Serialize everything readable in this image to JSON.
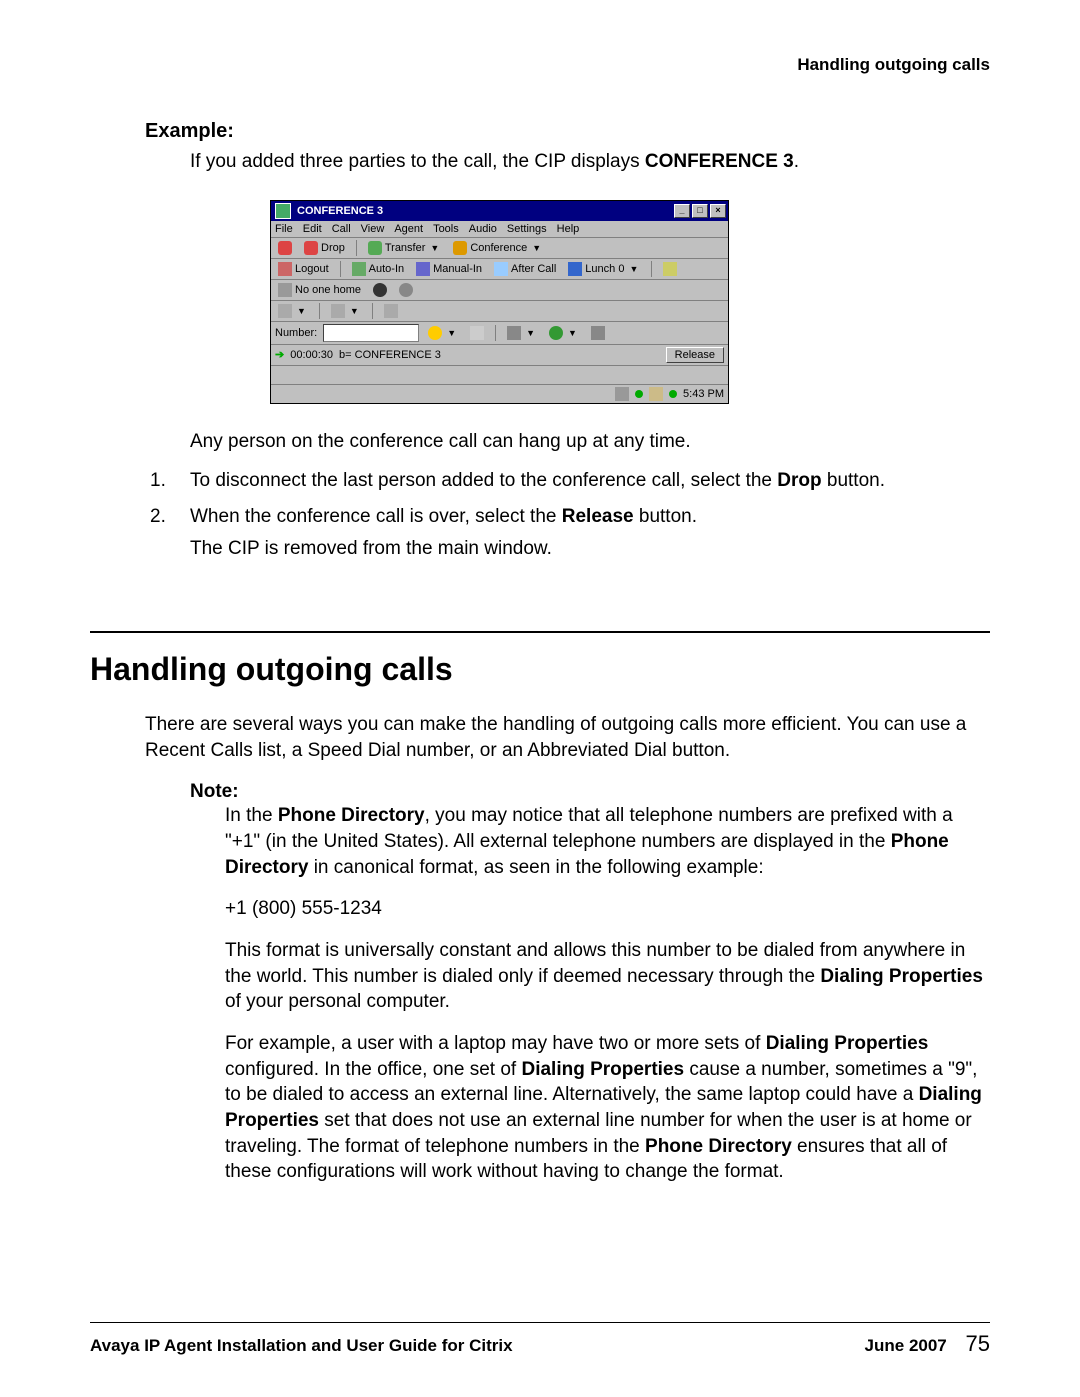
{
  "running_head": "Handling outgoing calls",
  "example": {
    "label": "Example:",
    "intro_before": "If you added three parties to the call, the CIP displays ",
    "intro_bold": "CONFERENCE 3",
    "intro_after": ".",
    "post_screenshot": "Any person on the conference call can hang up at any time.",
    "step1_before": "To disconnect the last person added to the conference call, select the ",
    "step1_bold": "Drop",
    "step1_after": " button.",
    "step2_before": "When the conference call is over, select the ",
    "step2_bold": "Release",
    "step2_after": " button.",
    "step2_line2": "The CIP is removed from the main window."
  },
  "cip": {
    "title": "CONFERENCE 3",
    "menus": [
      "File",
      "Edit",
      "Call",
      "View",
      "Agent",
      "Tools",
      "Audio",
      "Settings",
      "Help"
    ],
    "toolbar1": {
      "drop": "Drop",
      "transfer": "Transfer",
      "conference": "Conference"
    },
    "toolbar2": {
      "logout": "Logout",
      "autoin": "Auto-In",
      "manualin": "Manual-In",
      "aftercall": "After Call",
      "lunch": "Lunch 0"
    },
    "toolbar3": {
      "noonehome": "No one home"
    },
    "number_label": "Number:",
    "call": {
      "timer": "00:00:30",
      "label": "b=  CONFERENCE 3",
      "release": "Release"
    },
    "status_time": "5:43 PM"
  },
  "section": {
    "heading": "Handling outgoing calls",
    "intro": "There are several ways you can make the handling of outgoing calls more efficient. You can use a Recent Calls list, a Speed Dial number, or an Abbreviated Dial button."
  },
  "note": {
    "label": "Note:",
    "p1_a": "In the ",
    "p1_b1": "Phone Directory",
    "p1_b": ", you may notice that all telephone numbers are prefixed with a \"+1\" (in the United States). All external telephone numbers are displayed in the ",
    "p1_b2": "Phone Directory",
    "p1_c": " in canonical format, as seen in the following example:",
    "phone": "+1 (800) 555-1234",
    "p2_a": "This format is universally constant and allows this number to be dialed from anywhere in the world. This number is dialed only if deemed necessary through the ",
    "p2_b": "Dialing Properties",
    "p2_c": " of your personal computer.",
    "p3_a": "For example, a user with a laptop may have two or more sets of ",
    "p3_b1": "Dialing Properties",
    "p3_b": " configured. In the office, one set of ",
    "p3_b2": "Dialing Properties",
    "p3_c": " cause a number, sometimes a \"9\", to be dialed to access an external line. Alternatively, the same laptop could have a ",
    "p3_b3": "Dialing Properties",
    "p3_d": " set that does not use an external line number for when the user is at home or traveling. The format of telephone numbers in the ",
    "p3_b4": "Phone Directory",
    "p3_e": " ensures that all of these configurations will work without having to change the format."
  },
  "footer": {
    "left": "Avaya IP Agent Installation and User Guide for Citrix",
    "date": "June 2007",
    "page": "75"
  }
}
